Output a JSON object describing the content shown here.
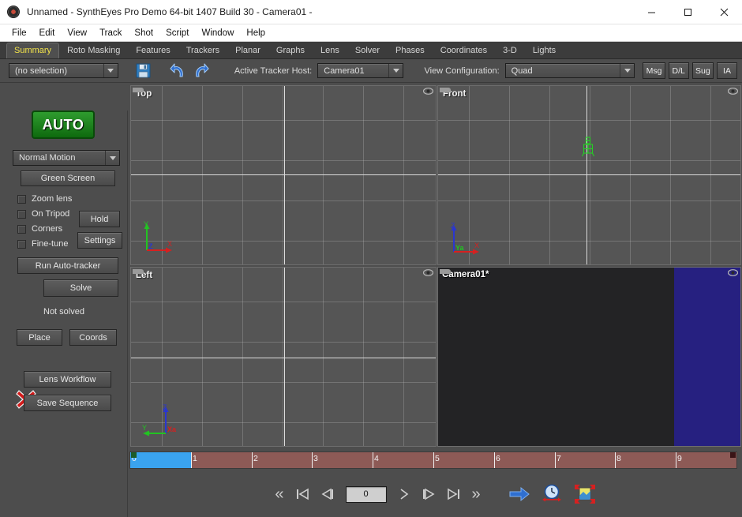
{
  "window": {
    "title": "Unnamed - SynthEyes Pro Demo 64-bit 1407 Build 30 - Camera01 -",
    "app_icon": "syntheyes-icon",
    "minimize_label": "–",
    "maximize_label": "□",
    "close_label": "✕"
  },
  "menubar": {
    "items": [
      {
        "label": "File"
      },
      {
        "label": "Edit"
      },
      {
        "label": "View"
      },
      {
        "label": "Track"
      },
      {
        "label": "Shot"
      },
      {
        "label": "Script"
      },
      {
        "label": "Window"
      },
      {
        "label": "Help"
      }
    ]
  },
  "tabs": {
    "active": "Summary",
    "items": [
      {
        "label": "Summary"
      },
      {
        "label": "Roto Masking"
      },
      {
        "label": "Features"
      },
      {
        "label": "Trackers"
      },
      {
        "label": "Planar"
      },
      {
        "label": "Graphs"
      },
      {
        "label": "Lens"
      },
      {
        "label": "Solver"
      },
      {
        "label": "Phases"
      },
      {
        "label": "Coordinates"
      },
      {
        "label": "3-D"
      },
      {
        "label": "Lights"
      }
    ]
  },
  "toolbar": {
    "selection_value": "(no selection)",
    "save_icon": "floppy-disk-icon",
    "undo_icon": "undo-arrow-icon",
    "redo_icon": "redo-arrow-icon",
    "active_tracker_host_label": "Active Tracker Host:",
    "active_tracker_host_value": "Camera01",
    "view_configuration_label": "View Configuration:",
    "view_configuration_value": "Quad",
    "buttons": [
      {
        "label": "Msg",
        "name": "msg-button"
      },
      {
        "label": "D/L",
        "name": "dl-button"
      },
      {
        "label": "Sug",
        "name": "sug-button"
      },
      {
        "label": "IA",
        "name": "ia-button"
      }
    ]
  },
  "sidebar": {
    "auto_label": "AUTO",
    "motion_value": "Normal Motion",
    "green_screen_label": "Green Screen",
    "checkboxes": [
      {
        "label": "Zoom lens",
        "checked": false
      },
      {
        "label": "On Tripod",
        "checked": false
      },
      {
        "label": "Corners",
        "checked": false
      },
      {
        "label": "Fine-tune",
        "checked": false
      }
    ],
    "hold_label": "Hold",
    "settings_label": "Settings",
    "run_autotracker_label": "Run Auto-tracker",
    "solve_label": "Solve",
    "solve_status_icon": "red-x-icon",
    "solve_status": "Not solved",
    "place_label": "Place",
    "coords_label": "Coords",
    "lens_workflow_label": "Lens Workflow",
    "save_sequence_label": "Save Sequence"
  },
  "viewports": [
    {
      "name": "viewport-top",
      "label": "Top",
      "gizmo": [
        "Y",
        "Z",
        "X"
      ]
    },
    {
      "name": "viewport-front",
      "label": "Front",
      "gizmo": [
        "Z",
        "Ya",
        "X"
      ]
    },
    {
      "name": "viewport-left",
      "label": "Left",
      "gizmo": [
        "Z",
        "Y",
        "Xa"
      ]
    },
    {
      "name": "viewport-camera",
      "label": "Camera01*",
      "gizmo": []
    }
  ],
  "timeline": {
    "ticks": [
      "0",
      "1",
      "2",
      "3",
      "4",
      "5",
      "6",
      "7",
      "8",
      "9"
    ],
    "selection_start": 0,
    "selection_end": 1,
    "track_color": "#8d5a56",
    "selection_color": "#3aa3ef"
  },
  "transport": {
    "frame_value": "0",
    "buttons": [
      {
        "name": "rewind-fast-button",
        "glyph": "«"
      },
      {
        "name": "go-to-start-button",
        "glyph": "⏮"
      },
      {
        "name": "step-back-button",
        "glyph": "⏴"
      },
      {
        "name": "play-forward-button",
        "glyph": "›"
      },
      {
        "name": "step-forward-button",
        "glyph": "⏵"
      },
      {
        "name": "go-to-end-button",
        "glyph": "⏭"
      },
      {
        "name": "forward-fast-button",
        "glyph": "»"
      }
    ],
    "icons": [
      {
        "name": "blue-arrow-icon"
      },
      {
        "name": "clock-range-icon"
      },
      {
        "name": "fit-image-icon"
      }
    ]
  }
}
